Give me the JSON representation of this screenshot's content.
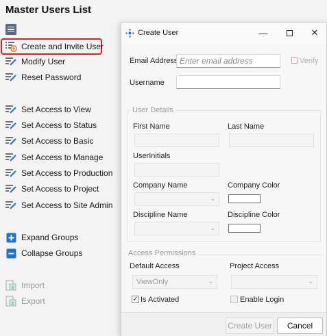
{
  "page": {
    "title": "Master Users List"
  },
  "sidebar": {
    "items": [
      {
        "label": "Create and Invite User"
      },
      {
        "label": "Modify User"
      },
      {
        "label": "Reset Password"
      },
      {
        "label": "Set Access to View"
      },
      {
        "label": "Set Access to Status"
      },
      {
        "label": "Set Access to Basic"
      },
      {
        "label": "Set Access to Manage"
      },
      {
        "label": "Set Access to Production"
      },
      {
        "label": "Set Access to Project"
      },
      {
        "label": "Set Access to Site Admin"
      },
      {
        "label": "Expand Groups"
      },
      {
        "label": "Collapse Groups"
      },
      {
        "label": "Import"
      },
      {
        "label": "Export"
      }
    ]
  },
  "dialog": {
    "title": "Create User",
    "email_label": "Email Address",
    "email_placeholder": "Enter email address",
    "verify_label": "Verify",
    "username_label": "Username",
    "username_value": "",
    "user_details": {
      "title": "User Details",
      "first_name_label": "First Name",
      "last_name_label": "Last Name",
      "user_initials_label": "UserInitials",
      "company_name_label": "Company Name",
      "company_color_label": "Company Color",
      "discipline_name_label": "Discipline Name",
      "discipline_color_label": "Discipline Color"
    },
    "access": {
      "title": "Access Permissions",
      "default_access_label": "Default Access",
      "default_access_value": "ViewOnly",
      "project_access_label": "Project Access",
      "project_access_value": "",
      "is_activated_label": "Is Activated",
      "is_activated_checked": true,
      "enable_login_label": "Enable Login",
      "enable_login_checked": false
    },
    "buttons": {
      "create": "Create User",
      "cancel": "Cancel"
    }
  },
  "colors": {
    "highlight": "#e02020",
    "icon_blue": "#1e73c8",
    "icon_orange": "#e8741e"
  }
}
